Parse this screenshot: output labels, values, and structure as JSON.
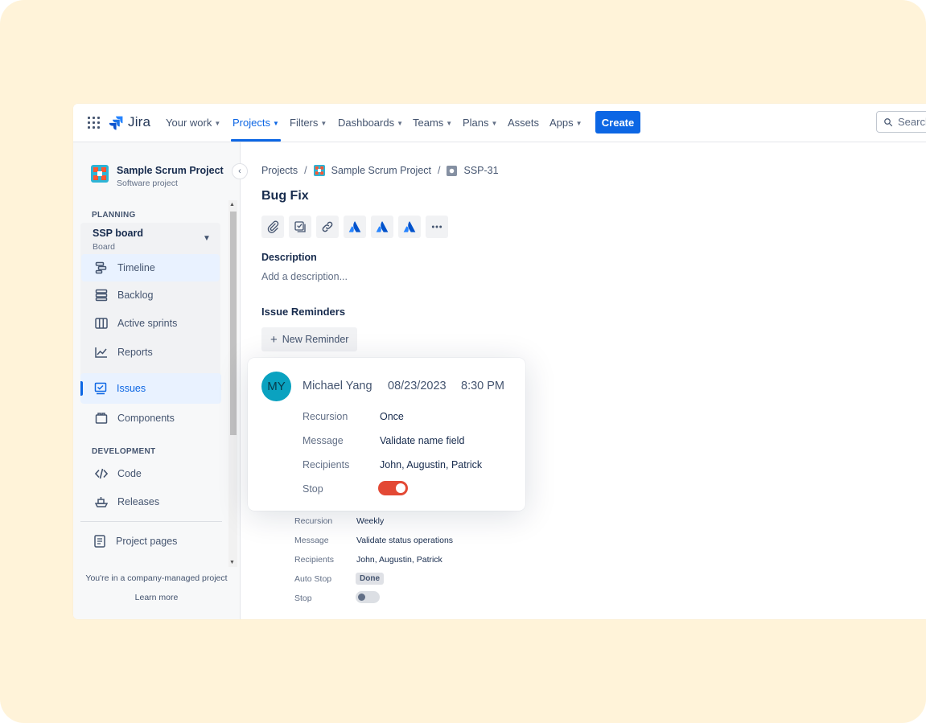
{
  "app": {
    "name": "Jira"
  },
  "nav": {
    "items": [
      {
        "label": "Your work",
        "chevron": true
      },
      {
        "label": "Projects",
        "chevron": true,
        "active": true
      },
      {
        "label": "Filters",
        "chevron": true
      },
      {
        "label": "Dashboards",
        "chevron": true
      },
      {
        "label": "Teams",
        "chevron": true
      },
      {
        "label": "Plans",
        "chevron": true
      },
      {
        "label": "Assets",
        "chevron": false
      },
      {
        "label": "Apps",
        "chevron": true
      }
    ],
    "create_label": "Create",
    "search_placeholder": "Search"
  },
  "sidebar": {
    "project_name": "Sample Scrum Project",
    "project_type": "Software project",
    "planning_label": "PLANNING",
    "board_title": "SSP board",
    "board_sub": "Board",
    "board_items": [
      "Timeline",
      "Backlog",
      "Active sprints",
      "Reports"
    ],
    "issues_label": "Issues",
    "components_label": "Components",
    "development_label": "DEVELOPMENT",
    "code_label": "Code",
    "releases_label": "Releases",
    "project_pages_label": "Project pages",
    "footer_text": "You're in a company-managed project",
    "learn_more": "Learn more"
  },
  "breadcrumb": {
    "root": "Projects",
    "project": "Sample Scrum Project",
    "issue_key": "SSP-31"
  },
  "issue": {
    "title": "Bug Fix",
    "description_label": "Description",
    "description_placeholder": "Add a description...",
    "reminders_label": "Issue Reminders",
    "new_reminder_label": "New Reminder"
  },
  "reminder_card": {
    "avatar_initials": "MY",
    "user": "Michael Yang",
    "date": "08/23/2023",
    "time": "8:30 PM",
    "rows": [
      {
        "label": "Recursion",
        "value": "Once"
      },
      {
        "label": "Message",
        "value": "Validate name field"
      },
      {
        "label": "Recipients",
        "value": "John, Augustin, Patrick"
      }
    ],
    "stop_label": "Stop",
    "stop_on": true
  },
  "reminder_two": {
    "rows": [
      {
        "label": "Recursion",
        "value": "Weekly"
      },
      {
        "label": "Message",
        "value": "Validate status operations"
      },
      {
        "label": "Recipients",
        "value": "John, Augustin, Patrick"
      }
    ],
    "auto_stop_label": "Auto Stop",
    "auto_stop_value": "Done",
    "stop_label": "Stop",
    "stop_on": false
  },
  "colors": {
    "accent": "#0c66e4",
    "toggle_on": "#e34935",
    "background": "#fff3d9"
  }
}
